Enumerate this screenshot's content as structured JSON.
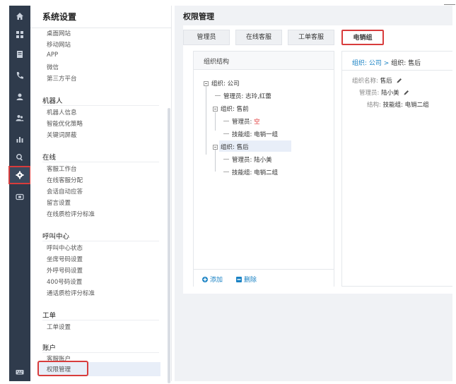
{
  "menu": {
    "title": "系统设置",
    "sections": [
      {
        "header": "",
        "items": [
          "桌面网站",
          "移动网站",
          "APP",
          "微信",
          "第三方平台"
        ]
      },
      {
        "header": "机器人",
        "items": [
          "机器人信息",
          "智能优化策略",
          "关键词屏蔽"
        ]
      },
      {
        "header": "在线",
        "items": [
          "客服工作台",
          "在线客服分配",
          "会话自动应答",
          "留言设置",
          "在线质检评分标准"
        ]
      },
      {
        "header": "呼叫中心",
        "items": [
          "呼叫中心状态",
          "坐席号码设置",
          "外呼号码设置",
          "400号码设置",
          "通话质检评分标准"
        ]
      },
      {
        "header": "工单",
        "items": [
          "工单设置"
        ]
      },
      {
        "header": "账户",
        "items": [
          "客服账户",
          "权限管理"
        ]
      }
    ]
  },
  "main": {
    "title": "权限管理",
    "tabs": [
      {
        "label": "管理员",
        "active": false
      },
      {
        "label": "在线客服",
        "active": false
      },
      {
        "label": "工单客服",
        "active": false
      },
      {
        "label": "电销组",
        "active": true
      }
    ],
    "tree": {
      "header": "组织结构",
      "nodes": {
        "root": "组织: 公司",
        "root_admin": "管理员: 志玲,红蕾",
        "presale": "组织: 售前",
        "presale_admin_label": "管理员: ",
        "presale_admin_value": "空",
        "presale_skill": "技能组: 电销一组",
        "aftersale": "组织: 售后",
        "aftersale_admin": "管理员: 陆小美",
        "aftersale_skill": "技能组: 电销二组"
      },
      "add_label": "添加",
      "delete_label": "删除"
    },
    "detail": {
      "path_root": "组织: 公司",
      "path_sep": ">",
      "path_current": "组织: 售后",
      "rows": [
        {
          "label": "组织名称:",
          "value": "售后"
        },
        {
          "label": "管理员:",
          "value": "陆小美"
        },
        {
          "label": "结构:",
          "value": "技能组: 电销二组"
        }
      ]
    }
  }
}
